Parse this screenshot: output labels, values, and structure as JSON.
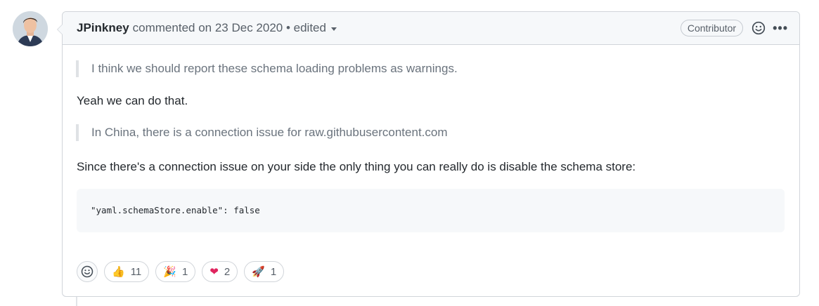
{
  "comment": {
    "author": "JPinkney",
    "meta": "commented on 23 Dec 2020 • edited",
    "badge": "Contributor",
    "kebab": "•••",
    "body": {
      "quote1": "I think we should report these schema loading problems as warnings.",
      "para1": "Yeah we can do that.",
      "quote2": "In China, there is a connection issue for raw.githubusercontent.com",
      "para2": "Since there's a connection issue on your side the only thing you can really do is disable the schema store:",
      "code": "\"yaml.schemaStore.enable\": false"
    },
    "reactions": [
      {
        "icon": "thumbs-up-icon",
        "emoji": "👍",
        "count": "11"
      },
      {
        "icon": "party-popper-icon",
        "emoji": "🎉",
        "count": "1"
      },
      {
        "icon": "heart-icon",
        "emoji": "❤",
        "count": "2"
      },
      {
        "icon": "rocket-icon",
        "emoji": "🚀",
        "count": "1"
      }
    ]
  },
  "colors": {
    "border": "#d1d5da",
    "header_bg": "#f6f8fa",
    "quote_text": "#6a737d",
    "heart": "#e0245e"
  }
}
